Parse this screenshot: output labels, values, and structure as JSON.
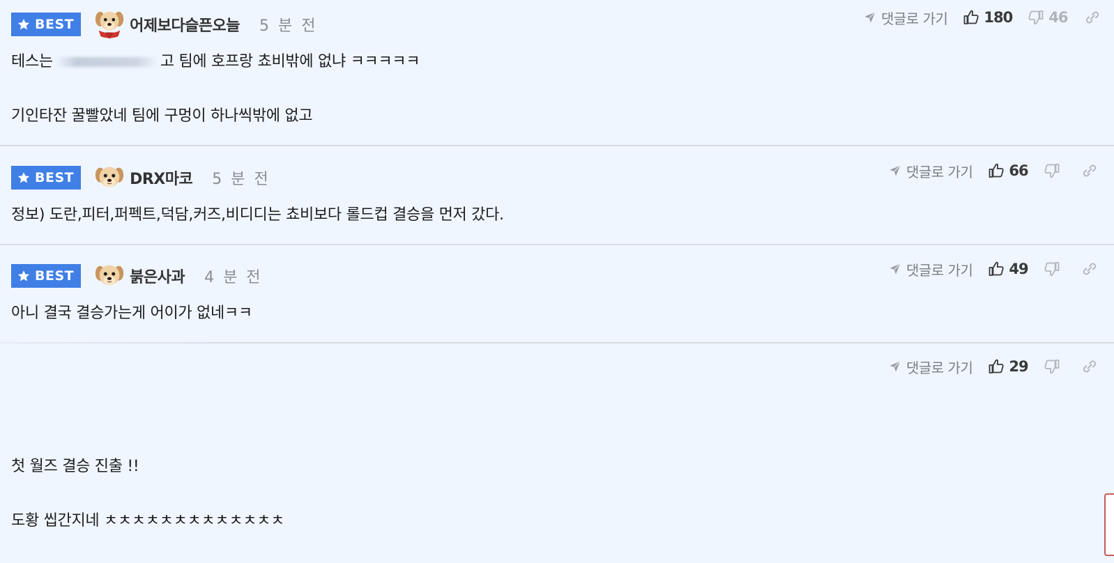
{
  "badge": {
    "label": "BEST"
  },
  "actions_common": {
    "reply_label": "댓글로 가기"
  },
  "comments": [
    {
      "best": true,
      "username": "어제보다슬픈오늘",
      "time": "5 분 전",
      "likes": "180",
      "dislikes": "46",
      "lines": [
        "테스는",
        "고 팀에 호프랑 쵸비밖에 없냐 ㅋㅋㅋㅋㅋ",
        "",
        "기인타잔 꿀빨았네 팀에 구멍이 하나씩밖에 없고"
      ],
      "avatar": "puppy-red-scarf"
    },
    {
      "best": true,
      "username": "DRX마코",
      "time": "5 분 전",
      "likes": "66",
      "dislikes": "",
      "lines": [
        "정보) 도란,피터,퍼펙트,덕담,커즈,비디디는 쵸비보다 롤드컵 결승을 먼저 갔다."
      ],
      "avatar": "puppy"
    },
    {
      "best": true,
      "username": "붉은사과",
      "time": "4 분 전",
      "likes": "49",
      "dislikes": "",
      "lines": [
        "아니 결국 결승가는게 어이가 없네ㅋㅋ"
      ],
      "avatar": "puppy"
    },
    {
      "best": false,
      "username": "",
      "time": "",
      "likes": "29",
      "dislikes": "",
      "lines": [
        "첫 월즈 결승 진출 !!",
        "",
        "도황 씹간지네 ㅊㅊㅊㅊㅊㅊㅊㅊㅊㅊㅊㅊㅊ"
      ],
      "avatar": ""
    }
  ],
  "colors": {
    "background": "#f0f6ff",
    "badge": "#3f7fe6",
    "divider": "#d9dde3",
    "muted": "#8a8d92"
  }
}
